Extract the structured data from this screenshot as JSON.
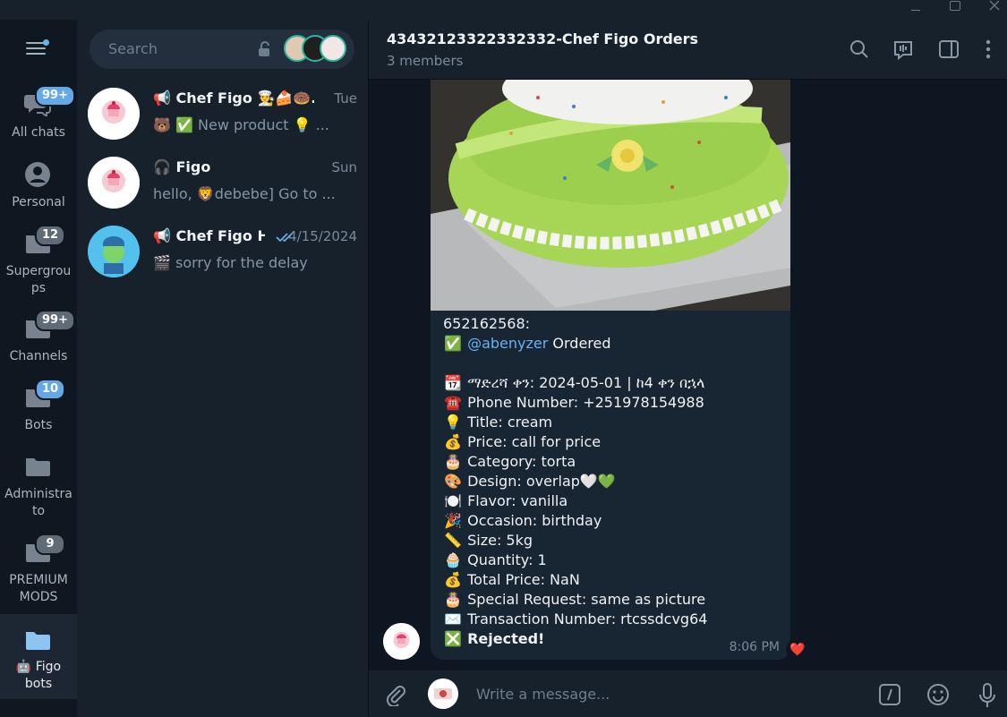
{
  "sidebar": {
    "folders": [
      {
        "label": "All chats",
        "badge": "99+",
        "icon": "chats-icon"
      },
      {
        "label": "Personal",
        "badge": "",
        "icon": "person-icon"
      },
      {
        "label": "Supergrou\nps",
        "line1": "Supergrou",
        "line2": "ps",
        "badge": "12",
        "icon": "folder-icon"
      },
      {
        "label": "Channels",
        "badge": "99+",
        "icon": "folder-icon"
      },
      {
        "label": "Bots",
        "badge": "10",
        "icon": "folder-icon"
      },
      {
        "label": "Administrato",
        "line1": "Administra",
        "line2": "to",
        "badge": "",
        "icon": "folder-icon"
      },
      {
        "label": "PREMIUM MODS",
        "line1": "PREMIUM",
        "line2": "MODS",
        "badge": "9",
        "icon": "folder-icon"
      },
      {
        "label": "🤖 Figo bots",
        "line1": "🤖 Figo",
        "line2": "bots",
        "badge": "",
        "icon": "folder-icon"
      }
    ]
  },
  "search": {
    "placeholder": "Search"
  },
  "chats": [
    {
      "name": "📢 Chef Figo 👨‍🍳🍰🍩...",
      "time": "Tue",
      "preview": "🐻 ✅ New product 💡 ..."
    },
    {
      "name": "🎧 Figo",
      "time": "Sun",
      "preview": "hello, 🦁debebe]   Go to ..."
    },
    {
      "name": "📢 Chef Figo H...",
      "time": "4/15/2024",
      "preview": "🎬 sorry for the delay"
    }
  ],
  "header": {
    "title": "43432123322332332-Chef Figo Orders",
    "subtitle": "3 members"
  },
  "message": {
    "lines": [
      {
        "emoji": "",
        "text": "652162568:"
      },
      {
        "emoji": "✅",
        "link": "@abenyzer",
        "text": " Ordered"
      },
      {
        "emoji": "",
        "text": ""
      },
      {
        "emoji": "📆",
        "text": "ማድረሻ ቀን:  2024-05-01 | ከ4 ቀን በኋላ"
      },
      {
        "emoji": "☎️",
        "text": "Phone Number: +251978154988"
      },
      {
        "emoji": "💡",
        "text": "Title: cream"
      },
      {
        "emoji": "💰",
        "text": "Price: call for price"
      },
      {
        "emoji": "🎂",
        "text": "Category: torta"
      },
      {
        "emoji": "🎨",
        "text": "Design: overlap🤍💚"
      },
      {
        "emoji": "🍽️",
        "text": "Flavor: vanilla"
      },
      {
        "emoji": "🎉",
        "text": "Occasion: birthday"
      },
      {
        "emoji": "📏",
        "text": "Size: 5kg"
      },
      {
        "emoji": "🧁",
        "text": "Quantity: 1"
      },
      {
        "emoji": "💰",
        "text": "Total Price: NaN"
      },
      {
        "emoji": "🎂",
        "text": "Special Request: same as picture"
      },
      {
        "emoji": "✉️",
        "text": "Transaction Number: rtcssdcvg64"
      }
    ],
    "status_emoji": "❎",
    "status": "Rejected!",
    "time": "8:06 PM",
    "reaction": "❤️"
  },
  "composer": {
    "placeholder": "Write a message..."
  },
  "colors": {
    "background": "#0e1621",
    "panel": "#17212b",
    "bubble": "#182533",
    "accent": "#64a9e6",
    "link": "#6ab2f2"
  }
}
